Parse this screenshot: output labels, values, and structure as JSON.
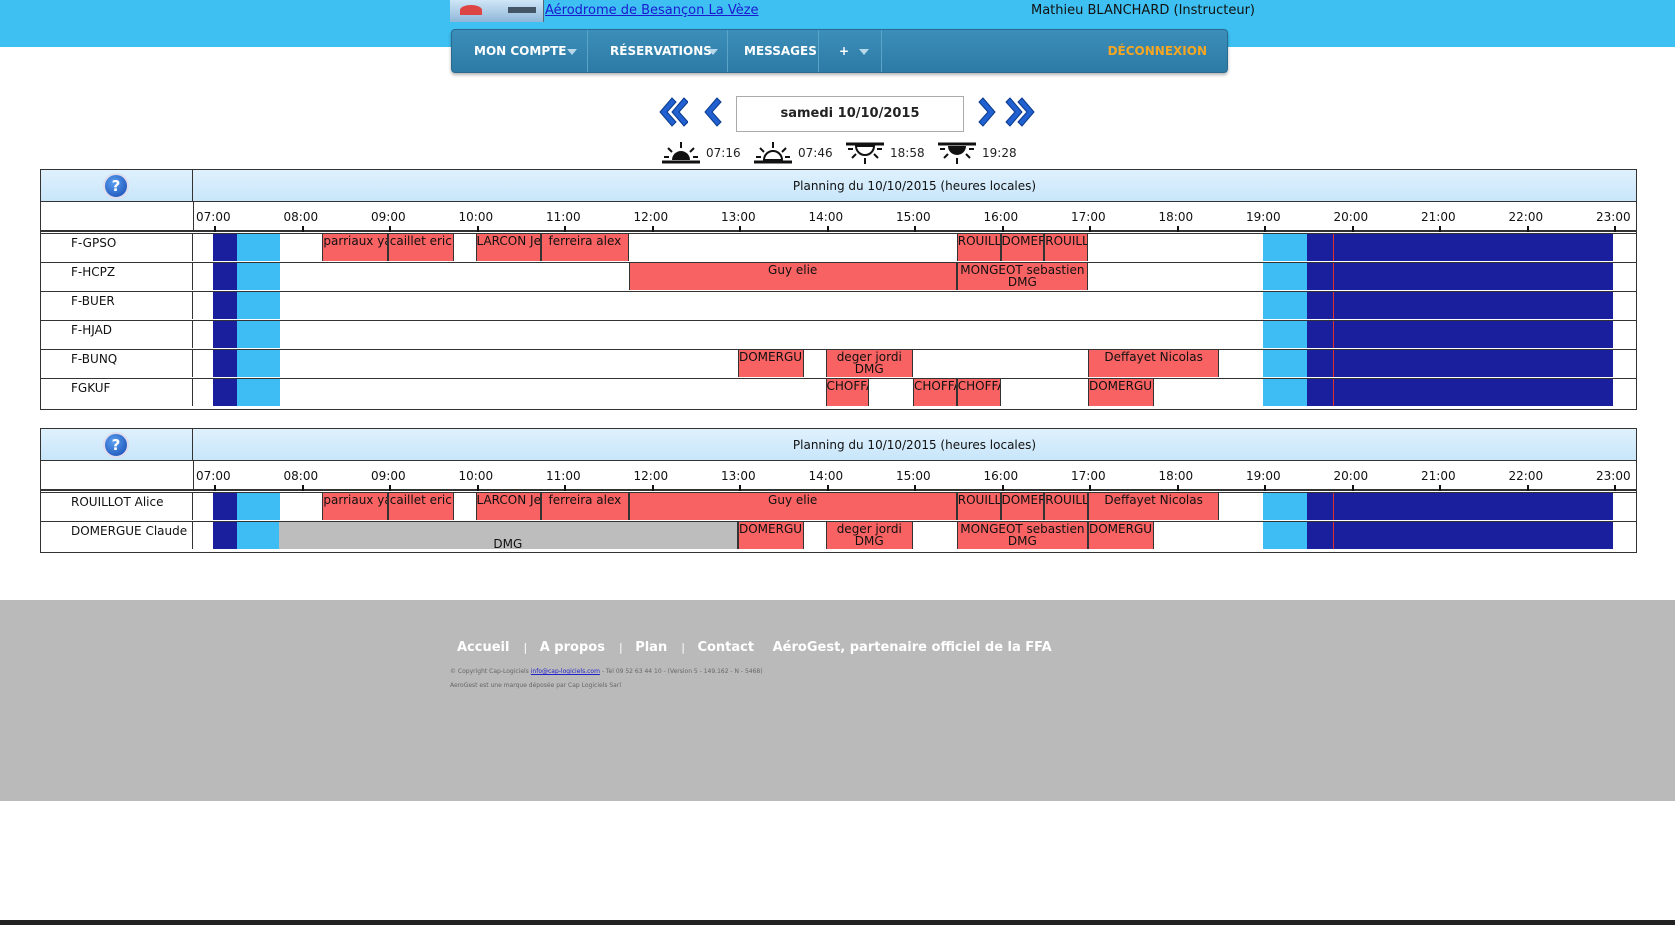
{
  "header": {
    "club_name": "Aérodrome de Besançon La Vèze",
    "user": "Mathieu BLANCHARD (Instructeur)"
  },
  "menu": {
    "account": "MON COMPTE",
    "reservations": "RÉSERVATIONS",
    "messages": "MESSAGES",
    "more": "+",
    "logout": "DÉCONNEXION"
  },
  "date_nav": {
    "date": "samedi 10/10/2015",
    "first": "«",
    "prev": "‹",
    "next": "›",
    "last": "»"
  },
  "sun": {
    "dawn": "07:16",
    "sunrise": "07:46",
    "sunset": "18:58",
    "dusk": "19:28"
  },
  "planning_title": "Planning du 10/10/2015 (heures locales)",
  "hours": [
    "07:00",
    "08:00",
    "09:00",
    "10:00",
    "11:00",
    "12:00",
    "13:00",
    "14:00",
    "15:00",
    "16:00",
    "17:00",
    "18:00",
    "19:00",
    "20:00",
    "21:00",
    "22:00",
    "23:00"
  ],
  "aircraft": [
    {
      "name": "F-GPSO",
      "bookings": [
        {
          "start": 8.25,
          "end": 9.0,
          "label": "parriaux ya"
        },
        {
          "start": 9.0,
          "end": 9.75,
          "label": "caillet eric"
        },
        {
          "start": 10.0,
          "end": 10.75,
          "label": "LARCON Je"
        },
        {
          "start": 10.75,
          "end": 11.75,
          "label": "ferreira alex"
        },
        {
          "start": 15.5,
          "end": 16.0,
          "label": "ROUILL"
        },
        {
          "start": 16.0,
          "end": 16.5,
          "label": "DOMER"
        },
        {
          "start": 16.5,
          "end": 17.0,
          "label": "ROUILL"
        }
      ]
    },
    {
      "name": "F-HCPZ",
      "bookings": [
        {
          "start": 11.75,
          "end": 15.5,
          "label": "Guy elie"
        },
        {
          "start": 15.5,
          "end": 17.0,
          "label": "MONGEOT sebastien",
          "label2": "DMG"
        }
      ]
    },
    {
      "name": "F-BUER",
      "bookings": []
    },
    {
      "name": "F-HJAD",
      "bookings": []
    },
    {
      "name": "F-BUNQ",
      "bookings": [
        {
          "start": 13.0,
          "end": 13.75,
          "label": "DOMERGUE"
        },
        {
          "start": 14.0,
          "end": 15.0,
          "label": "deger jordi",
          "label2": "DMG"
        },
        {
          "start": 17.0,
          "end": 18.5,
          "label": "Deffayet Nicolas"
        }
      ]
    },
    {
      "name": "FGKUF",
      "bookings": [
        {
          "start": 14.0,
          "end": 14.5,
          "label": "CHOFFA"
        },
        {
          "start": 15.0,
          "end": 15.5,
          "label": "CHOFFA"
        },
        {
          "start": 15.5,
          "end": 16.0,
          "label": "CHOFFA"
        },
        {
          "start": 17.0,
          "end": 17.75,
          "label": "DOMERGUE"
        }
      ]
    }
  ],
  "people": [
    {
      "name": "ROUILLOT Alice",
      "bookings": [
        {
          "start": 8.25,
          "end": 9.0,
          "label": "parriaux ya"
        },
        {
          "start": 9.0,
          "end": 9.75,
          "label": "caillet eric"
        },
        {
          "start": 10.0,
          "end": 10.75,
          "label": "LARCON Je"
        },
        {
          "start": 10.75,
          "end": 11.75,
          "label": "ferreira alex"
        },
        {
          "start": 11.75,
          "end": 15.5,
          "label": "Guy elie"
        },
        {
          "start": 15.5,
          "end": 16.0,
          "label": "ROUILL"
        },
        {
          "start": 16.0,
          "end": 16.5,
          "label": "DOMER"
        },
        {
          "start": 16.5,
          "end": 17.0,
          "label": "ROUILL"
        },
        {
          "start": 17.0,
          "end": 18.5,
          "label": "Deffayet Nicolas"
        }
      ]
    },
    {
      "name": "DOMERGUE Claude",
      "unavailable": {
        "start": 7.75,
        "end": 13.0,
        "label": "DMG"
      },
      "bookings": [
        {
          "start": 13.0,
          "end": 13.75,
          "label": "DOMERGUE"
        },
        {
          "start": 14.0,
          "end": 15.0,
          "label": "deger jordi",
          "label2": "DMG"
        },
        {
          "start": 15.5,
          "end": 17.0,
          "label": "MONGEOT sebastien",
          "label2": "DMG"
        },
        {
          "start": 17.0,
          "end": 17.75,
          "label": "DOMERGUE"
        }
      ]
    }
  ],
  "night": {
    "morning_end": 7.27,
    "twilight_morning_end": 7.77,
    "twilight_evening_start": 19.0,
    "night_start": 19.5,
    "day_end": 23.0
  },
  "now": 19.8,
  "footer": {
    "links": [
      "Accueil",
      "A propos",
      "Plan",
      "Contact"
    ],
    "partner": "AéroGest, partenaire officiel de la FFA",
    "copyright_pre": "© Copyright Cap-Logiciels",
    "email": "info@cap-logiciels.com",
    "copyright_post": "- Tel 09 52 63 44 10 - (Version 5 - 149.162 - N - 5468)",
    "trademark": "AeroGest est une marque déposée par Cap Logiciels Sarl"
  },
  "colors": {
    "booking": "#f96262",
    "night": "#1a1f9e",
    "twilight": "#3ebdf4",
    "unavailable": "#bdbdbd",
    "topbar": "#3ec0f2"
  }
}
